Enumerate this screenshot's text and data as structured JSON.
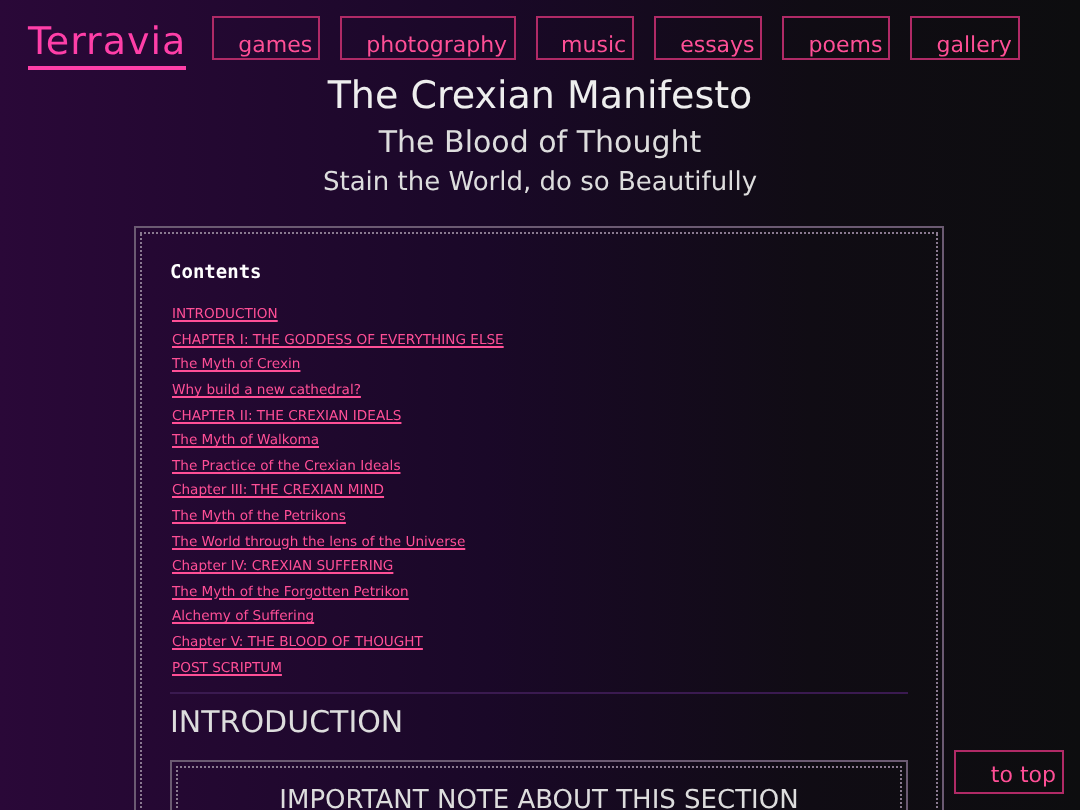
{
  "site_logo": "Terravia",
  "nav": [
    "games",
    "photography",
    "music",
    "essays",
    "poems",
    "gallery"
  ],
  "titles": [
    "The Crexian Manifesto",
    "The Blood of Thought",
    "Stain the World, do so Beautifully"
  ],
  "contents": {
    "heading": "Contents",
    "links": [
      "INTRODUCTION",
      "CHAPTER I: THE GODDESS OF EVERYTHING ELSE",
      "The Myth of Crexin",
      "Why build a new cathedral?",
      "CHAPTER II: THE CREXIAN IDEALS",
      "The Myth of Walkoma",
      "The Practice of the Crexian Ideals",
      "Chapter III: THE CREXIAN MIND",
      "The Myth of the Petrikons",
      "The World through the lens of the Universe",
      "Chapter IV: CREXIAN SUFFERING",
      "The Myth of the Forgotten Petrikon",
      "Alchemy of Suffering",
      "Chapter V: THE BLOOD OF THOUGHT",
      "POST SCRIPTUM"
    ]
  },
  "section": {
    "heading": "INTRODUCTION",
    "note_title": "IMPORTANT NOTE ABOUT THIS SECTION"
  },
  "to_top": "to top"
}
